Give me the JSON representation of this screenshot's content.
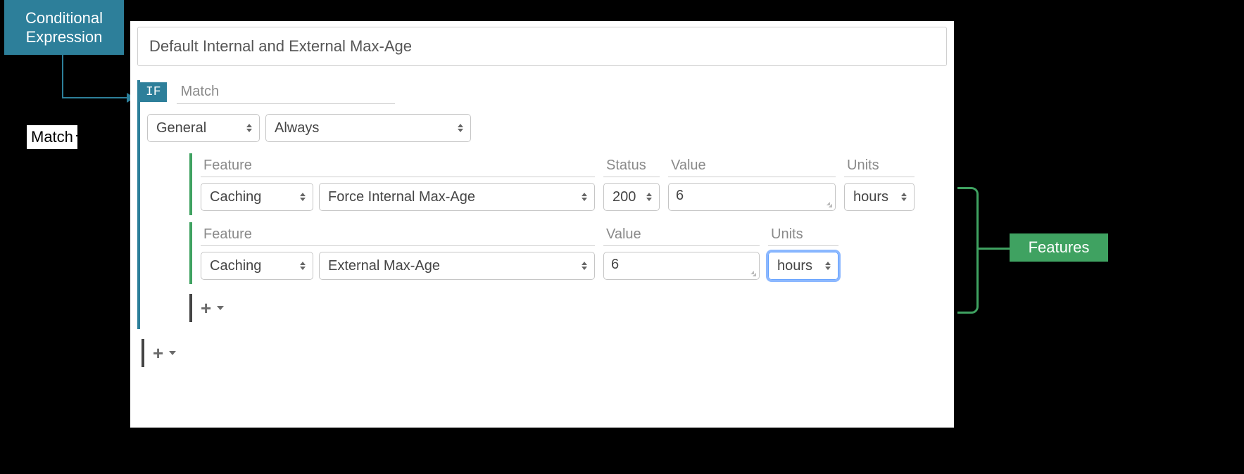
{
  "annotations": {
    "conditional_expression": "Conditional Expression",
    "match": "Match",
    "features": "Features"
  },
  "rule": {
    "title": "Default Internal and External Max-Age",
    "if_badge": "IF",
    "if_label": "Match",
    "match": {
      "category": "General",
      "condition": "Always"
    },
    "features": [
      {
        "headers": {
          "feature": "Feature",
          "status": "Status",
          "value": "Value",
          "units": "Units"
        },
        "category": "Caching",
        "name": "Force Internal Max-Age",
        "status": "200",
        "value": "6",
        "units": "hours"
      },
      {
        "headers": {
          "feature": "Feature",
          "value": "Value",
          "units": "Units"
        },
        "category": "Caching",
        "name": "External Max-Age",
        "value": "6",
        "units": "hours"
      }
    ]
  },
  "icons": {
    "plus": "+"
  }
}
